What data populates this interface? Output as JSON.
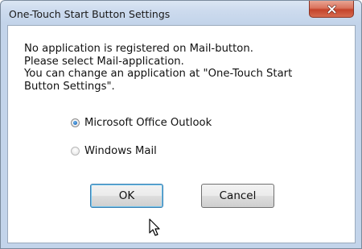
{
  "dialog": {
    "title": "One-Touch Start Button Settings",
    "close_icon": "close-x-icon",
    "accent_close": "#c4432b"
  },
  "message": {
    "lines": [
      "No application is registered on Mail-button.",
      "Please select Mail-application.",
      "You can change an application at \"One-Touch Start",
      "Button Settings\"."
    ]
  },
  "options": [
    {
      "label": "Microsoft Office Outlook",
      "selected": true
    },
    {
      "label": "Windows Mail",
      "selected": false
    }
  ],
  "buttons": {
    "ok_label": "OK",
    "cancel_label": "Cancel"
  },
  "cursor_icon": "mouse-pointer-icon"
}
